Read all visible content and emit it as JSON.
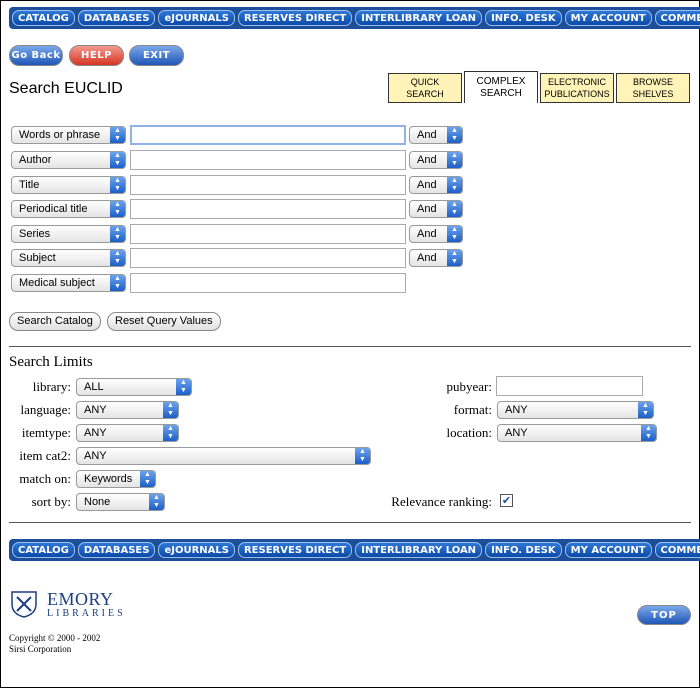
{
  "nav": [
    "CATALOG",
    "DATABASES",
    "eJOURNALS",
    "RESERVES DIRECT",
    "INTERLIBRARY LOAN",
    "INFO. DESK",
    "MY ACCOUNT",
    "COMMENT"
  ],
  "actions": {
    "back": "Go Back",
    "help": "HELP",
    "exit": "EXIT"
  },
  "title": "Search EUCLID",
  "tabs": [
    {
      "line1": "QUICK",
      "line2": "SEARCH"
    },
    {
      "line1": "COMPLEX",
      "line2": "SEARCH"
    },
    {
      "line1": "ELECTRONIC",
      "line2": "PUBLICATIONS"
    },
    {
      "line1": "BROWSE",
      "line2": "SHELVES"
    }
  ],
  "query_rows": [
    {
      "field": "Words or phrase",
      "value": "",
      "op": "And"
    },
    {
      "field": "Author",
      "value": "",
      "op": "And"
    },
    {
      "field": "Title",
      "value": "",
      "op": "And"
    },
    {
      "field": "Periodical title",
      "value": "",
      "op": "And"
    },
    {
      "field": "Series",
      "value": "",
      "op": "And"
    },
    {
      "field": "Subject",
      "value": "",
      "op": "And"
    },
    {
      "field": "Medical subject",
      "value": ""
    }
  ],
  "buttons": {
    "search": "Search Catalog",
    "reset": "Reset Query Values"
  },
  "limits": {
    "title": "Search Limits",
    "library": {
      "label": "library:",
      "value": "ALL"
    },
    "language": {
      "label": "language:",
      "value": "ANY"
    },
    "itemtype": {
      "label": "itemtype:",
      "value": "ANY"
    },
    "itemcat2": {
      "label": "item cat2:",
      "value": "ANY"
    },
    "matchon": {
      "label": "match on:",
      "value": "Keywords"
    },
    "sortby": {
      "label": "sort by:",
      "value": "None"
    },
    "pubyear": {
      "label": "pubyear:",
      "value": ""
    },
    "format": {
      "label": "format:",
      "value": "ANY"
    },
    "location": {
      "label": "location:",
      "value": "ANY"
    },
    "relevance": {
      "label": "Relevance ranking:",
      "checked": true
    }
  },
  "footer": {
    "logo_name": "EMORY",
    "logo_sub": "LIBRARIES",
    "copyright1": "Copyright © 2000 - 2002",
    "copyright2": "Sirsi Corporation",
    "top": "TOP"
  }
}
